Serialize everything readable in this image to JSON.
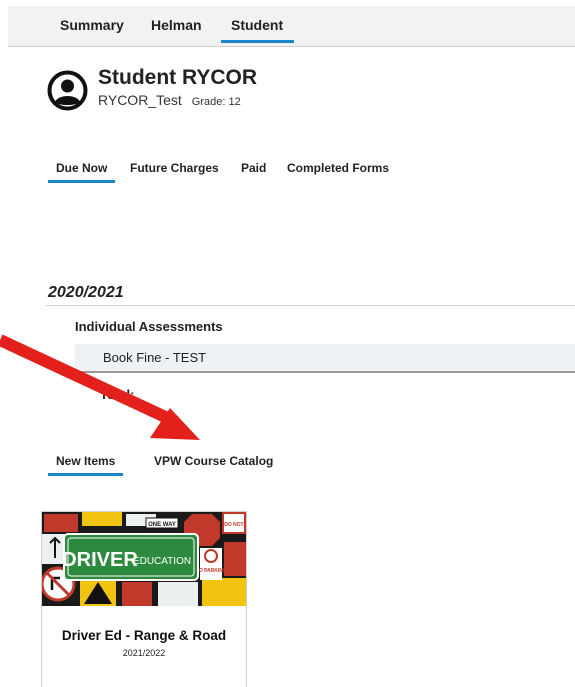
{
  "topnav": {
    "tabs": [
      {
        "label": "Summary"
      },
      {
        "label": "Helman"
      },
      {
        "label": "Student"
      }
    ]
  },
  "student": {
    "name": "Student RYCOR",
    "username": "RYCOR_Test",
    "grade": "Grade: 12"
  },
  "fee_tabs": [
    {
      "label": "Due Now"
    },
    {
      "label": "Future Charges"
    },
    {
      "label": "Paid"
    },
    {
      "label": "Completed Forms"
    }
  ],
  "fees": {
    "year": "2020/2021",
    "category": "Individual Assessments",
    "items": [
      {
        "name": "Book Fine - TEST"
      }
    ],
    "total_label": "Total:"
  },
  "catalog_tabs": [
    {
      "label": "New Items"
    },
    {
      "label": "VPW Course Catalog"
    }
  ],
  "course_card": {
    "title": "Driver Ed - Range & Road",
    "year": "2021/2022",
    "image_text_main": "DRIVER",
    "image_text_sub": "EDUCATION",
    "sign_one_way": "ONE WAY",
    "sign_no_parking": "NO PARKING",
    "sign_do_not": "DO NOT"
  },
  "colors": {
    "accent": "#1a86c8",
    "arrow": "#e3201b",
    "sign_green": "#2c8a3f"
  }
}
